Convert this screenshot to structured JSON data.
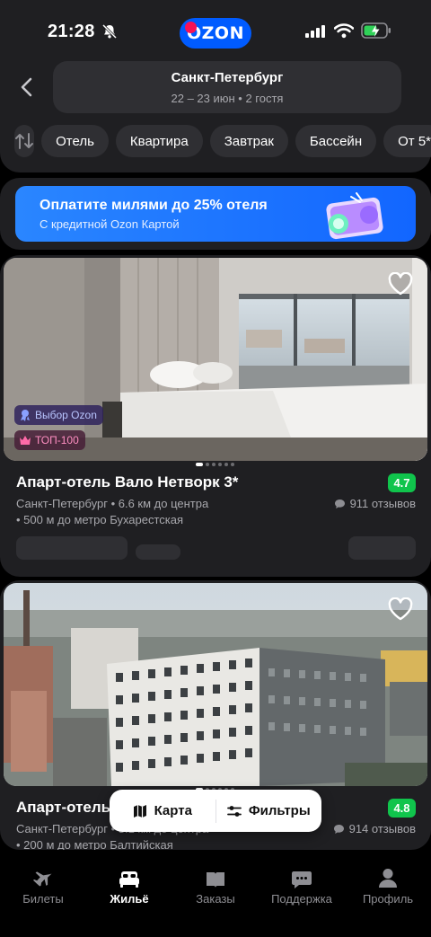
{
  "status": {
    "time": "21:28"
  },
  "brand": {
    "logo_text": "OZON",
    "color": "#005bff"
  },
  "search": {
    "city": "Санкт-Петербург",
    "dates": "22 – 23 июн • 2 гостя"
  },
  "filters": [
    "Отель",
    "Квартира",
    "Завтрак",
    "Бассейн",
    "От 5*"
  ],
  "promo": {
    "title": "Оплатите милями до 25% отеля",
    "subtitle": "С кредитной Ozon Картой"
  },
  "hotels": [
    {
      "name": "Апарт-отель Вало Нетворк 3*",
      "rating": "4.7",
      "info": "Санкт-Петербург • 6.6 км до центра",
      "metro": "• 500 м до метро Бухарестская",
      "reviews": "911 отзывов",
      "badges": [
        "Выбор Ozon",
        "ТОП-100"
      ]
    },
    {
      "name": "Апарт-отель",
      "rating": "4.8",
      "info": "Санкт-Петербург • 8.1 км до центра",
      "metro": "• 200 м до метро Балтийская",
      "reviews": "914 отзывов"
    }
  ],
  "floating": {
    "map": "Карта",
    "filters": "Фильтры"
  },
  "tabs": [
    "Билеты",
    "Жильё",
    "Заказы",
    "Поддержка",
    "Профиль"
  ],
  "colors": {
    "accent": "#005bff",
    "rating": "#10c44c",
    "card": "#1f1f22"
  }
}
